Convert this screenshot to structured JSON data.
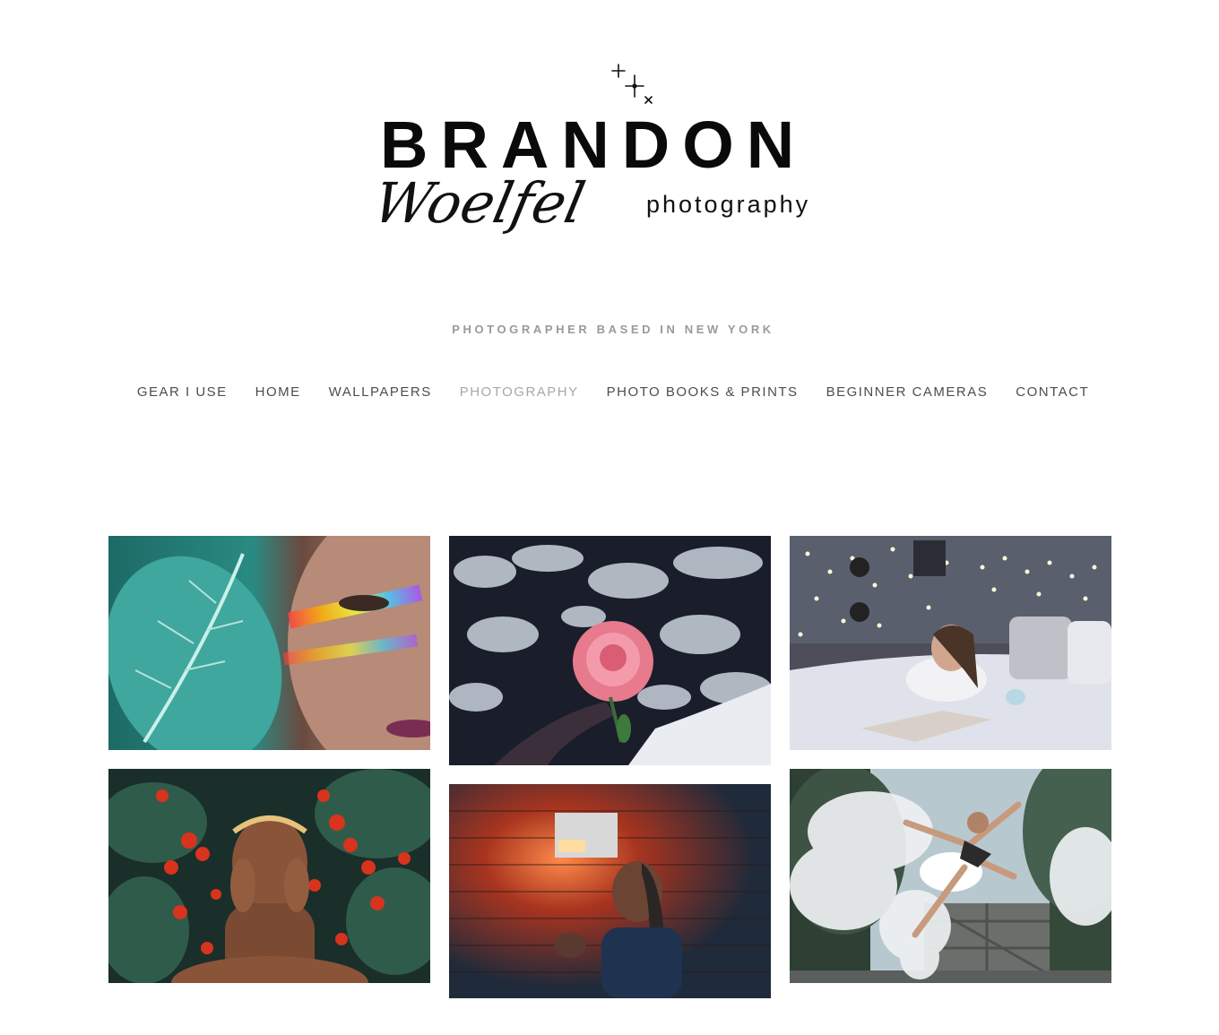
{
  "logo": {
    "name": "BRANDON",
    "script": "Woelfel",
    "suffix": "photography"
  },
  "tagline": "PHOTOGRAPHER BASED IN NEW YORK",
  "nav": {
    "items": [
      {
        "label": "GEAR I USE",
        "active": false
      },
      {
        "label": "HOME",
        "active": false
      },
      {
        "label": "WALLPAPERS",
        "active": false
      },
      {
        "label": "PHOTOGRAPHY",
        "active": true
      },
      {
        "label": "PHOTO BOOKS & PRINTS",
        "active": false
      },
      {
        "label": "BEGINNER CAMERAS",
        "active": false
      },
      {
        "label": "CONTACT",
        "active": false
      }
    ]
  },
  "colors": {
    "nav_text": "#4d4d4d",
    "nav_active": "#a8a8a8",
    "tagline": "#9a9a9a"
  },
  "gallery": {
    "photos": [
      {
        "subject": "portrait with leaf and rainbow light"
      },
      {
        "subject": "pink rose held against snowy tree"
      },
      {
        "subject": "woman reading in bed with string lights"
      },
      {
        "subject": "portrait among red berries"
      },
      {
        "subject": "portrait by brick wall lamp"
      },
      {
        "subject": "ballerina leaping with smoke"
      }
    ]
  }
}
